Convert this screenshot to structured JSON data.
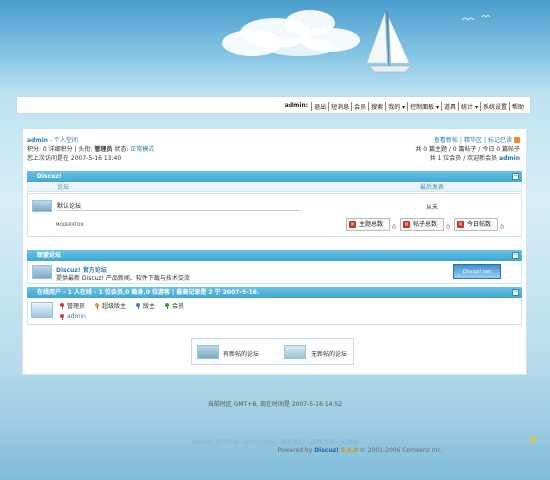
{
  "nav": {
    "user": "admin:",
    "items": [
      "退出",
      "短消息",
      "会员",
      "搜索",
      "我的 ▾",
      "控制面板 ▾",
      "道具",
      "统计 ▾",
      "系统设置",
      "帮助"
    ]
  },
  "user_info": {
    "name": "admin",
    "space_link": " - 个人空间",
    "line2_prefix": "积分: 0  详细积分 | 头衔: ",
    "title": "管理员",
    "line2_status_label": "  状态: ",
    "status": "正常模式",
    "last_visit": "您上次访问是在 2007-5-16 13:40"
  },
  "stats": {
    "links": [
      "查看新帖",
      "精华区",
      "标记已读"
    ],
    "line2": "共 0 篇主题 / 0 篇帖子 / 今日 0 篇帖子",
    "line3_prefix": "共 1 位会员 / 欢迎新会员 ",
    "new_member": "admin"
  },
  "category": {
    "title": "Discuz!",
    "col_forum": "论坛",
    "col_last_post": "最后发表",
    "forum_name": "默认论坛",
    "last_post": "从未",
    "moderator_label": "MODERATOR:",
    "buttons": [
      {
        "label": "主题总数",
        "value": "0"
      },
      {
        "label": "帖子总数",
        "value": "0"
      },
      {
        "label": "今日帖数",
        "value": "0"
      }
    ]
  },
  "links_section": {
    "title": "联盟论坛",
    "site_name": "Discuz! 官方论坛",
    "site_desc": "提供最新 Discuz! 产品新闻、软件下载与技术交流",
    "logo_text": "Discuz!.net"
  },
  "online": {
    "title": "在线用户 - 1 人在线 - 1 位会员,0 隐身,0 位游客 | 最高记录是 2 于 2007-5-16.",
    "legend": [
      "管理员",
      "超级版主",
      "版主",
      "会员"
    ],
    "user": "admin"
  },
  "legend_box": {
    "new_posts": "有新帖的论坛",
    "no_new_posts": "无新帖的论坛"
  },
  "footer": {
    "time": "当前时区 GMT+8, 现在时间是 2007-5-16 14:52",
    "links": "Discuz! 官方论坛 - 2007 论坛 - 联系我们 - 回到顶部 - 无图版",
    "powered_prefix": "Powered by ",
    "brand": "Discuz!",
    "version": "5.5.0",
    "copyright": " © 2001-2006 Comsenz Inc."
  }
}
